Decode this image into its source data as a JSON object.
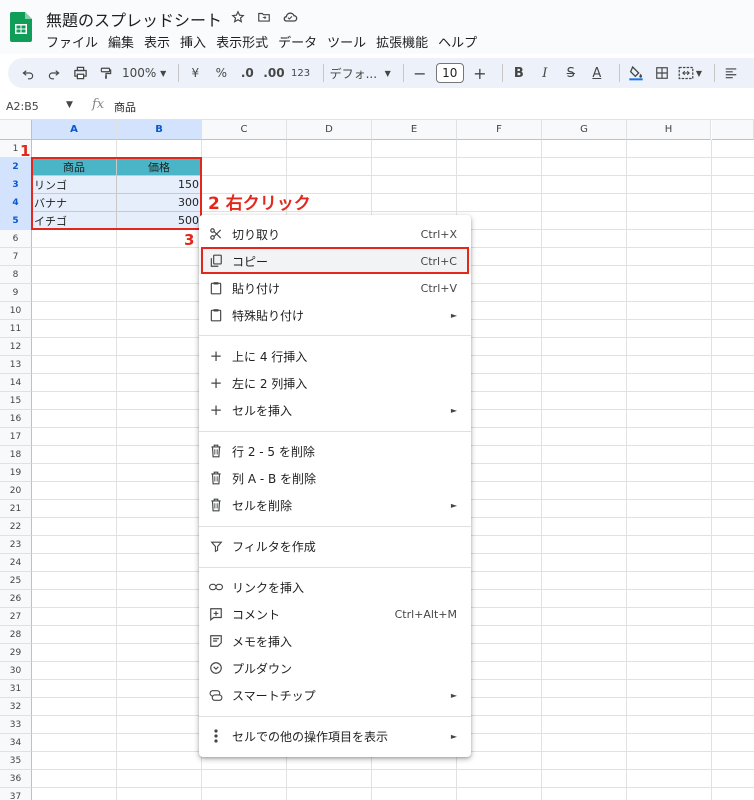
{
  "app": {
    "doc_title": "無題のスプレッドシート",
    "menu": [
      "ファイル",
      "編集",
      "表示",
      "挿入",
      "表示形式",
      "データ",
      "ツール",
      "拡張機能",
      "ヘルプ"
    ]
  },
  "toolbar": {
    "zoom": "100%",
    "currency": "¥",
    "percent": "%",
    "dec_decrease": ".0",
    "dec_increase": ".00",
    "number_format": "123",
    "font": "デフォ...",
    "font_size": "10"
  },
  "formula_bar": {
    "name_box": "A2:B5",
    "fx": "fx",
    "value": "商品"
  },
  "columns": [
    "A",
    "B",
    "C",
    "D",
    "E",
    "F",
    "G",
    "H"
  ],
  "rows": [
    "1",
    "2",
    "3",
    "4",
    "5",
    "6",
    "7",
    "8",
    "9",
    "10",
    "11",
    "12",
    "13",
    "14",
    "15",
    "16",
    "17",
    "18",
    "19",
    "20",
    "21",
    "22",
    "23",
    "24",
    "25",
    "26",
    "27",
    "28",
    "29",
    "30",
    "31",
    "32",
    "33",
    "34",
    "35",
    "36",
    "37"
  ],
  "sheet": {
    "header": [
      "商品",
      "価格"
    ],
    "data": [
      [
        "リンゴ",
        "150"
      ],
      [
        "バナナ",
        "300"
      ],
      [
        "イチゴ",
        "500"
      ]
    ]
  },
  "annotations": {
    "step1": "1",
    "step2": "2 右クリック",
    "step3": "3"
  },
  "context_menu": {
    "items": [
      {
        "icon": "scissors-icon",
        "label": "切り取り",
        "shortcut": "Ctrl+X"
      },
      {
        "icon": "copy-icon",
        "label": "コピー",
        "shortcut": "Ctrl+C"
      },
      {
        "icon": "paste-icon",
        "label": "貼り付け",
        "shortcut": "Ctrl+V"
      },
      {
        "icon": "paste-special-icon",
        "label": "特殊貼り付け",
        "submenu": "►"
      },
      {
        "icon": "plus-icon",
        "label": "上に 4 行挿入"
      },
      {
        "icon": "plus-icon",
        "label": "左に 2 列挿入"
      },
      {
        "icon": "plus-icon",
        "label": "セルを挿入",
        "submenu": "►"
      },
      {
        "icon": "trash-icon",
        "label": "行 2 - 5 を削除"
      },
      {
        "icon": "trash-icon",
        "label": "列 A - B を削除"
      },
      {
        "icon": "trash-icon",
        "label": "セルを削除",
        "submenu": "►"
      },
      {
        "icon": "filter-icon",
        "label": "フィルタを作成"
      },
      {
        "icon": "link-icon",
        "label": "リンクを挿入"
      },
      {
        "icon": "comment-icon",
        "label": "コメント",
        "shortcut": "Ctrl+Alt+M"
      },
      {
        "icon": "note-icon",
        "label": "メモを挿入"
      },
      {
        "icon": "dropdown-icon",
        "label": "プルダウン"
      },
      {
        "icon": "smart-chip-icon",
        "label": "スマートチップ",
        "submenu": "►"
      },
      {
        "icon": "more-vert-icon",
        "label": "セルでの他の操作項目を表示",
        "submenu": "►"
      }
    ]
  },
  "colors": {
    "accent_red": "#e3271a",
    "header_fill": "#4bb5c8",
    "selection_fill": "#e6eefc",
    "sheets_green": "#0f9d58"
  }
}
